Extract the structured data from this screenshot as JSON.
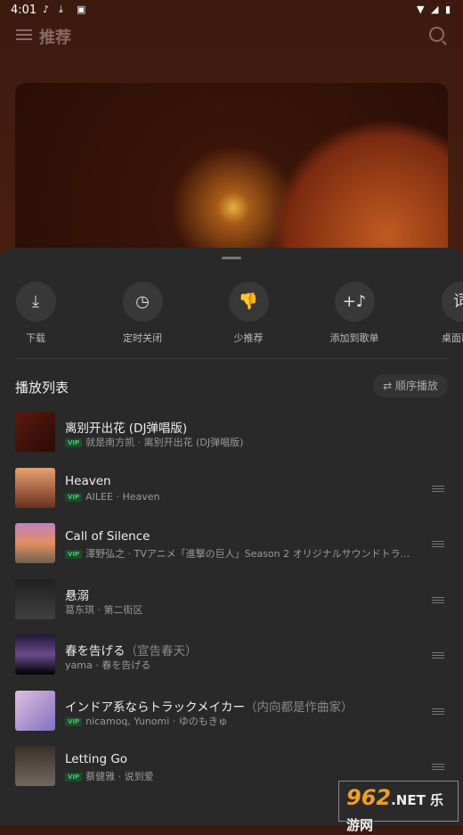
{
  "status": {
    "time": "4:01",
    "icons": [
      "music-note-icon",
      "download-icon",
      "a-icon",
      "wifi-icon",
      "signal-icon",
      "battery-icon"
    ]
  },
  "appbar": {
    "title": "推荐",
    "menu_icon": "menu-icon",
    "search_icon": "search-icon"
  },
  "sheet": {
    "actions": [
      {
        "label": "下载",
        "icon": "download-icon",
        "glyph": "⤓"
      },
      {
        "label": "定时关闭",
        "icon": "timer-icon",
        "glyph": "◷"
      },
      {
        "label": "少推荐",
        "icon": "thumbs-down-icon",
        "glyph": "👎"
      },
      {
        "label": "添加到歌单",
        "icon": "add-to-playlist-icon",
        "glyph": "+♪"
      },
      {
        "label": "桌面歌词",
        "icon": "lyrics-icon",
        "glyph": "词"
      }
    ],
    "playlist_title": "播放列表",
    "mode_label": "⇄ 顺序播放",
    "songs": [
      {
        "title": "离别开出花 (DJ弹唱版)",
        "translation": "",
        "vip": true,
        "subtitle": "就是南方凯 · 离别开出花 (DJ弹唱版)",
        "playing": true
      },
      {
        "title": "Heaven",
        "translation": "",
        "vip": true,
        "subtitle": "AILEE · Heaven"
      },
      {
        "title": "Call of Silence",
        "translation": "",
        "vip": true,
        "subtitle": "澤野弘之 · TVアニメ「進撃の巨人」Season 2 オリジナルサウンドトラ..."
      },
      {
        "title": "悬溺",
        "translation": "",
        "vip": false,
        "subtitle": "葛东琪 · 第二街区"
      },
      {
        "title": "春を告げる",
        "translation": "（宣告春天）",
        "vip": false,
        "subtitle": "yama · 春を告げる"
      },
      {
        "title": "インドア系ならトラックメイカー",
        "translation": "（内向都是作曲家）",
        "vip": true,
        "subtitle": "nicamoq, Yunomi · ゆのもきゅ"
      },
      {
        "title": "Letting Go",
        "translation": "",
        "vip": true,
        "subtitle": "蔡健雅 · 说到爱"
      }
    ],
    "vip_label": "VIP"
  },
  "watermark": {
    "text": "962.NET 乐游网"
  },
  "colors": {
    "sheet": "#292929",
    "vip_green": "#3dcc6a",
    "header_bg": "#3c1a10"
  }
}
